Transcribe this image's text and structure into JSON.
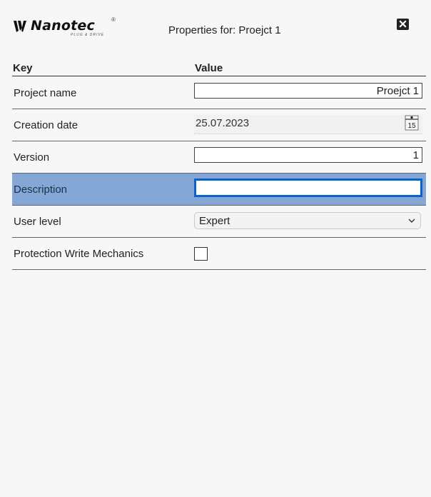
{
  "header": {
    "logo_text": "Nanotec",
    "logo_reg": "®",
    "logo_tagline": "PLUG & DRIVE",
    "title": "Properties for: Proejct 1",
    "close_icon": "close-icon"
  },
  "table": {
    "key_header": "Key",
    "value_header": "Value",
    "rows": [
      {
        "key": "Project name",
        "value": "Proejct 1",
        "type": "text"
      },
      {
        "key": "Creation date",
        "value": "25.07.2023",
        "type": "date",
        "calendar_day": "15"
      },
      {
        "key": "Version",
        "value": "1",
        "type": "text"
      },
      {
        "key": "Description",
        "value": "",
        "type": "text",
        "selected": true
      },
      {
        "key": "User level",
        "value": "Expert",
        "type": "select"
      },
      {
        "key": "Protection Write Mechanics",
        "value": "unchecked",
        "type": "checkbox"
      }
    ]
  },
  "colors": {
    "selected_row": "#84a7d6",
    "focus_border": "#0a63c9",
    "background": "#f7f7f7"
  }
}
